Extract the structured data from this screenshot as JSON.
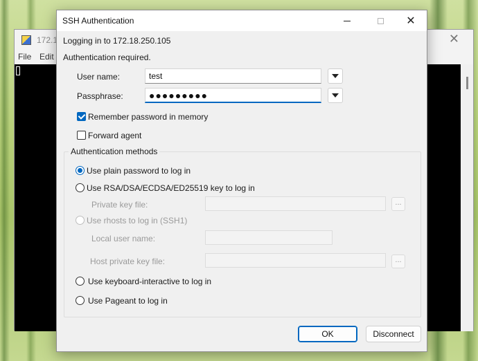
{
  "background_window": {
    "title": "172.1",
    "menu": [
      "File",
      "Edit"
    ]
  },
  "dialog": {
    "title": "SSH Authentication",
    "logging_in": "Logging in to 172.18.250.105",
    "auth_required": "Authentication required.",
    "username": {
      "label": "User name:",
      "value": "test"
    },
    "passphrase": {
      "label": "Passphrase:",
      "value": "●●●●●●●●●"
    },
    "remember_password": {
      "label": "Remember password in memory",
      "checked": true
    },
    "forward_agent": {
      "label": "Forward agent",
      "checked": false
    },
    "auth_methods": {
      "title": "Authentication methods",
      "plain_password": "Use plain password to log in",
      "key": "Use RSA/DSA/ECDSA/ED25519 key to log in",
      "private_key_label": "Private key file:",
      "rhosts": "Use rhosts to log in (SSH1)",
      "local_user_label": "Local user name:",
      "host_key_label": "Host private key file:",
      "keyboard_interactive": "Use keyboard-interactive to log in",
      "pageant": "Use Pageant to log in",
      "browse": "...",
      "selected": "plain_password"
    },
    "ok_label": "OK",
    "disconnect_label": "Disconnect"
  },
  "colors": {
    "accent": "#0067c0",
    "terminal_bg": "#000000",
    "dialog_bg": "#f0f0f0"
  }
}
